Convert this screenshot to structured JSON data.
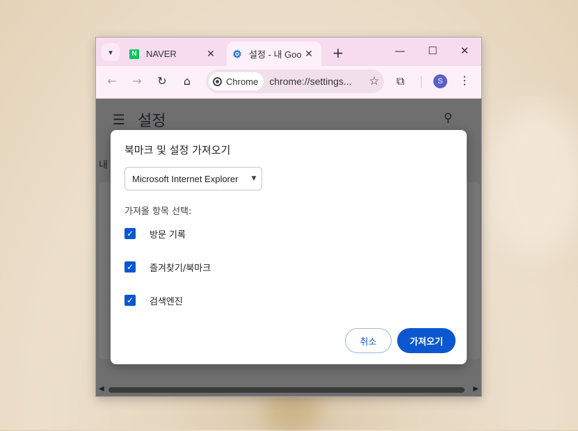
{
  "window": {
    "tabs": [
      {
        "title": "NAVER",
        "favicon": "naver-logo",
        "favicon_text": "N",
        "active": false
      },
      {
        "title": "설정 - 내 Goo",
        "favicon": "gear-icon",
        "active": true
      }
    ],
    "new_tab_symbol": "+",
    "controls": {
      "minimize": "—",
      "maximize": "☐",
      "close": "✕"
    }
  },
  "toolbar": {
    "chip_label": "Chrome",
    "url": "chrome://settings...",
    "profile_initial": "S"
  },
  "settings": {
    "title": "설정",
    "subheading": "내"
  },
  "dialog": {
    "title": "북마크 및 설정 가져오기",
    "browser_select": {
      "value": "Microsoft Internet Explorer"
    },
    "items_label": "가져올 항목 선택:",
    "items": [
      {
        "label": "방문 기록",
        "checked": true
      },
      {
        "label": "즐겨찾기/북마크",
        "checked": true
      },
      {
        "label": "검색엔진",
        "checked": true
      }
    ],
    "cancel_label": "취소",
    "import_label": "가져오기"
  },
  "colors": {
    "accent": "#0b57d0",
    "tabstrip": "#f7dcef",
    "toolbar": "#fdf0f8",
    "overlay": "#6f6f6f"
  }
}
